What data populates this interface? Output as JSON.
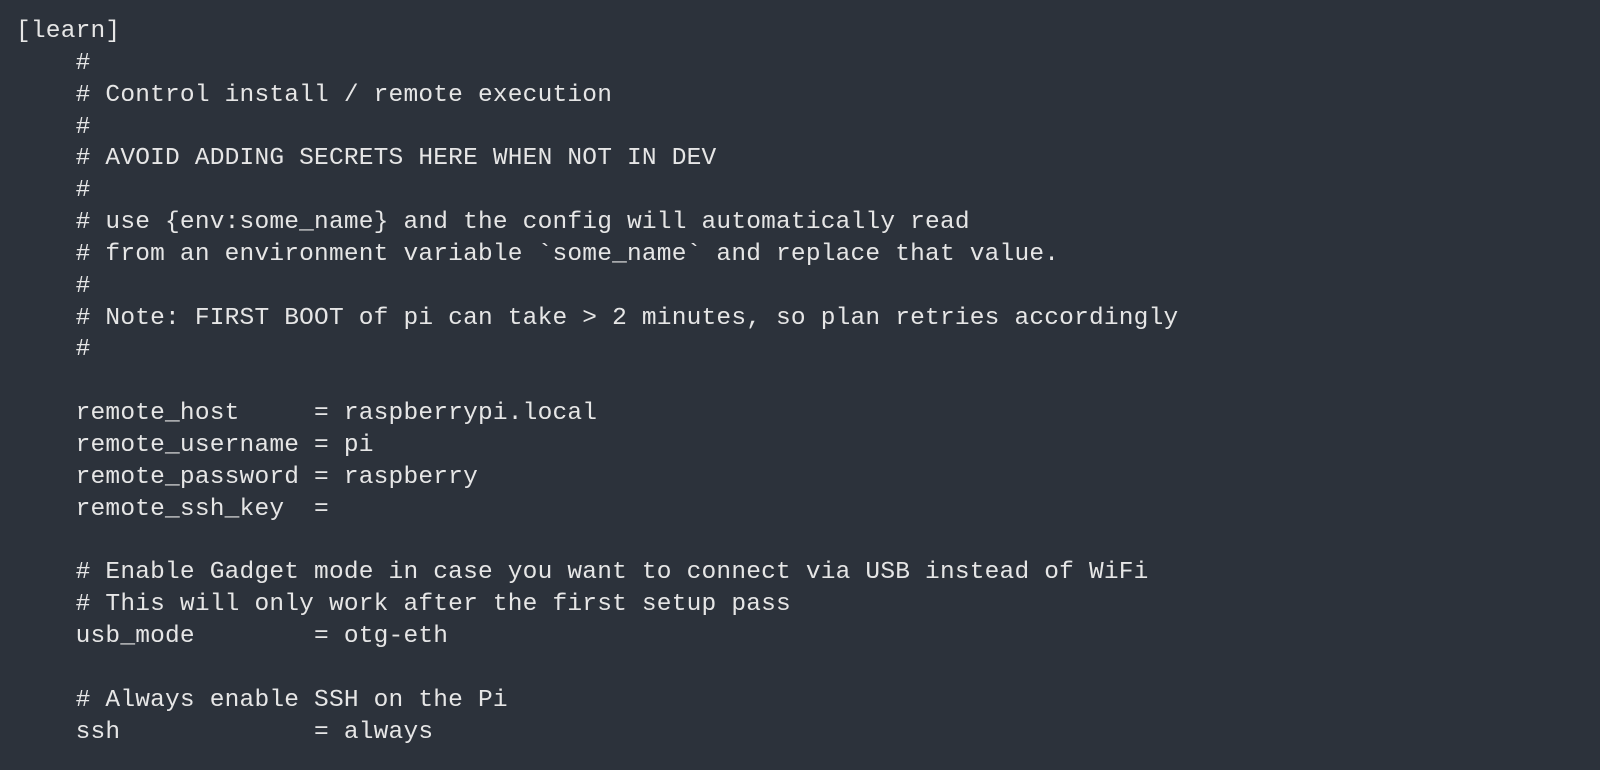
{
  "code": {
    "lines": [
      "[learn]",
      "    #",
      "    # Control install / remote execution",
      "    #",
      "    # AVOID ADDING SECRETS HERE WHEN NOT IN DEV",
      "    #",
      "    # use {env:some_name} and the config will automatically read",
      "    # from an environment variable `some_name` and replace that value.",
      "    #",
      "    # Note: FIRST BOOT of pi can take > 2 minutes, so plan retries accordingly",
      "    #",
      "",
      "    remote_host     = raspberrypi.local",
      "    remote_username = pi",
      "    remote_password = raspberry",
      "    remote_ssh_key  =",
      "",
      "    # Enable Gadget mode in case you want to connect via USB instead of WiFi",
      "    # This will only work after the first setup pass",
      "    usb_mode        = otg-eth",
      "",
      "    # Always enable SSH on the Pi",
      "    ssh             = always"
    ]
  }
}
